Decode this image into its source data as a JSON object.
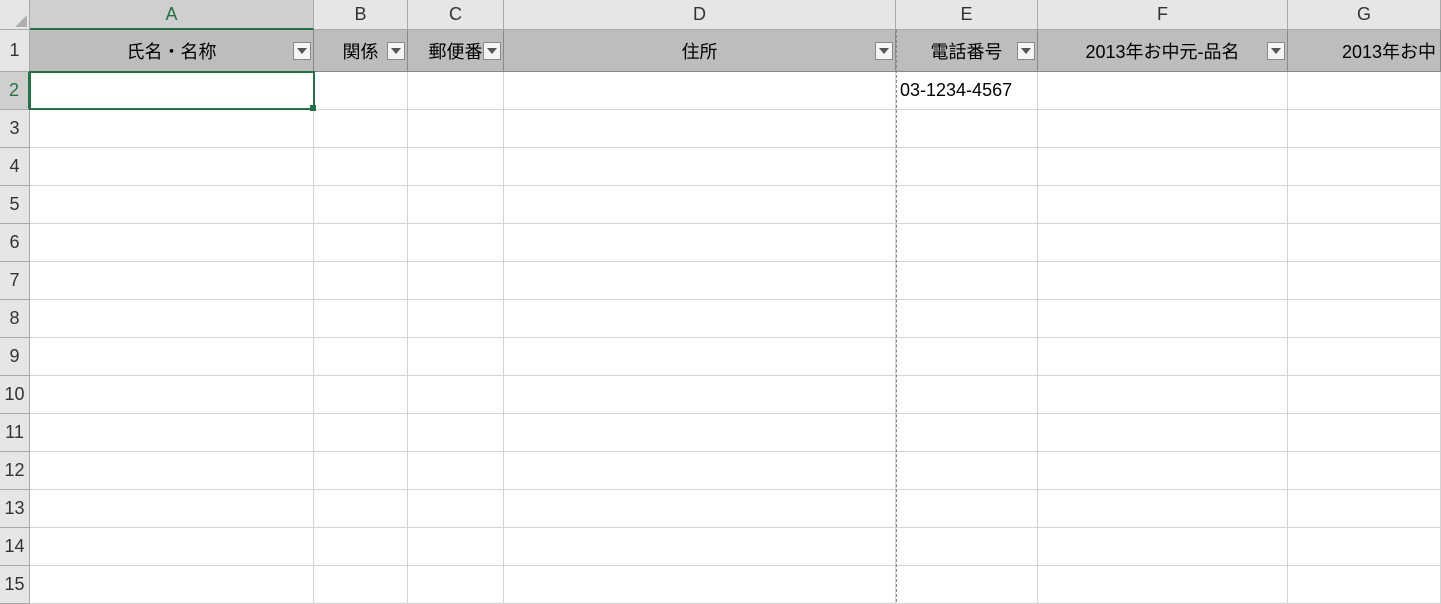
{
  "columns": [
    {
      "letter": "A",
      "header": "氏名・名称",
      "active": true
    },
    {
      "letter": "B",
      "header": "関係"
    },
    {
      "letter": "C",
      "header": "郵便番"
    },
    {
      "letter": "D",
      "header": "住所"
    },
    {
      "letter": "E",
      "header": "電話番号"
    },
    {
      "letter": "F",
      "header": "2013年お中元-品名"
    },
    {
      "letter": "G",
      "header": "2013年お中"
    }
  ],
  "rowNumbers": [
    1,
    2,
    3,
    4,
    5,
    6,
    7,
    8,
    9,
    10,
    11,
    12,
    13,
    14,
    15
  ],
  "data": {
    "E2": "03-1234-4567"
  },
  "activeRow": 2,
  "selectedCell": "A2"
}
